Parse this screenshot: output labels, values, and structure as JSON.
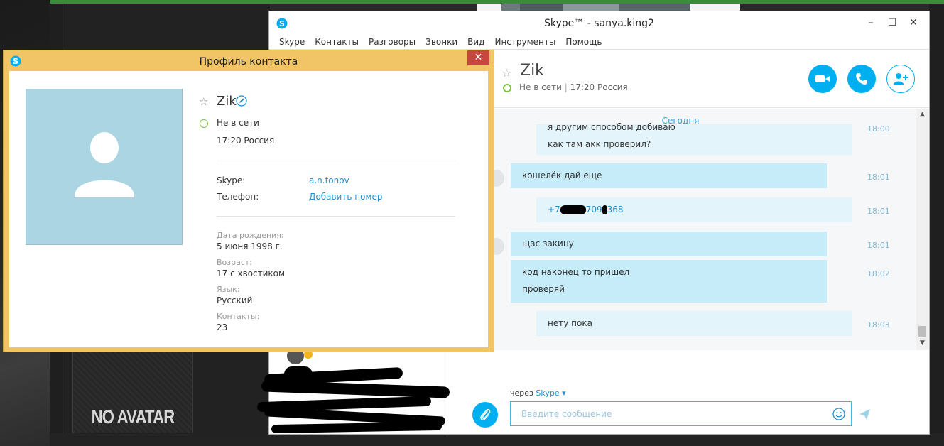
{
  "background": {
    "no_avatar_text": "NO AVATAR"
  },
  "skype_window": {
    "title": "Skype™ - sanya.king2",
    "menu": [
      "Skype",
      "Контакты",
      "Разговоры",
      "Звонки",
      "Вид",
      "Инструменты",
      "Помощь"
    ],
    "conversation": {
      "name": "Zik",
      "status": "Не в сети",
      "local_info": "17:20 Россия",
      "day_separator": "Сегодня",
      "messages": [
        {
          "direction": "out",
          "lines": [
            "я другим способом добиваю",
            "как там акк проверил?"
          ],
          "time": "18:00"
        },
        {
          "direction": "in",
          "lines": [
            "кошелёк дай еще"
          ],
          "time": "18:01"
        },
        {
          "direction": "out",
          "lines": [
            "+7",
            "709",
            "368"
          ],
          "time": "18:01"
        },
        {
          "direction": "in",
          "lines": [
            "щас закину"
          ],
          "time": "18:01"
        },
        {
          "direction": "in",
          "lines": [
            "код наконец то пришел",
            "проверяй"
          ],
          "time": "18:02"
        },
        {
          "direction": "out",
          "lines": [
            "нету пока"
          ],
          "time": "18:03"
        }
      ],
      "composer": {
        "via_prefix": "через",
        "via_service": "Skype ▾",
        "placeholder": "Введите сообщение"
      }
    }
  },
  "profile_dialog": {
    "title": "Профиль контакта",
    "name": "Zik",
    "status": "Не в сети",
    "local_info": "17:20 Россия",
    "skype_label": "Skype:",
    "skype_value": "a.n.tonov",
    "phone_label": "Телефон:",
    "phone_action": "Добавить номер",
    "details": [
      {
        "label": "Дата рождения:",
        "value": "5 июня 1998 г."
      },
      {
        "label": "Возраст:",
        "value": "17 с хвостиком"
      },
      {
        "label": "Язык:",
        "value": "Русский"
      },
      {
        "label": "Контакты:",
        "value": "23"
      }
    ]
  },
  "colors": {
    "skype_blue": "#00aff0",
    "incoming_bubble": "#c7ecf9",
    "outgoing_bubble": "#e3f4fb",
    "online_ring": "#7cc242",
    "dialog_frame": "#f1c566",
    "close_red": "#c7463d"
  }
}
